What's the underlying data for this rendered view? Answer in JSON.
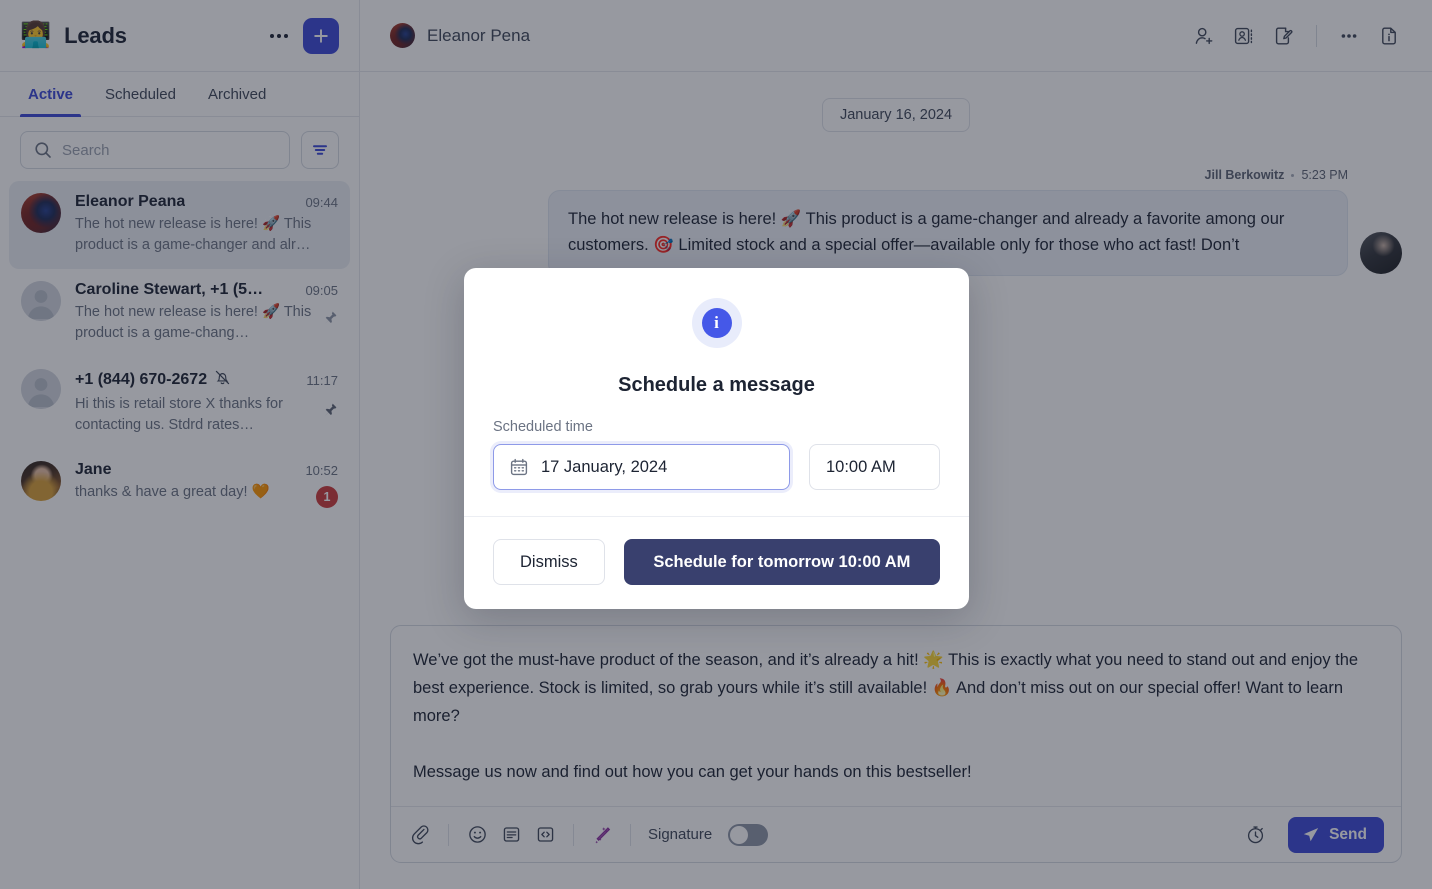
{
  "sidebar": {
    "emoji": "👩‍💻",
    "title": "Leads",
    "more_label": "",
    "add_label": "+",
    "tabs": [
      {
        "label": "Active",
        "active": true
      },
      {
        "label": "Scheduled",
        "active": false
      },
      {
        "label": "Archived",
        "active": false
      }
    ],
    "search": {
      "value": "",
      "placeholder": "Search"
    },
    "filter_icon": "filter-icon",
    "conversations": [
      {
        "name": "Eleanor Peana",
        "time": "09:44",
        "preview": "The hot new release is here! 🚀 This product is a game-changer and alr…",
        "selected": true,
        "pinned": false,
        "muted": false,
        "unread": "",
        "avatar": "eleanor"
      },
      {
        "name": "Caroline Stewart, +1 (54…",
        "time": "09:05",
        "preview": "The hot new release is here! 🚀 This product is a game-chang…",
        "selected": false,
        "pinned": true,
        "muted": false,
        "unread": "",
        "avatar": "generic"
      },
      {
        "name": "+1 (844) 670-2672",
        "time": "11:17",
        "preview": "Hi this is retail store X thanks for contacting us. Stdrd rates…",
        "selected": false,
        "pinned": true,
        "muted": true,
        "unread": "",
        "avatar": "generic"
      },
      {
        "name": "Jane",
        "time": "10:52",
        "preview": "thanks & have a great day! 🧡",
        "selected": false,
        "pinned": false,
        "muted": false,
        "unread": "1",
        "avatar": "jane"
      }
    ]
  },
  "header": {
    "contact_name": "Eleanor Pena",
    "actions": [
      "add-person-icon",
      "contact-card-icon",
      "document-edit-icon",
      "more-options-icon",
      "document-info-icon"
    ]
  },
  "thread": {
    "date_divider": "January 16, 2024",
    "message": {
      "author": "Jill Berkowitz",
      "time": "5:23 PM",
      "text": "The hot new release is here! 🚀 This product is a game-changer and already a favorite among our customers. 🎯 Limited stock and a special offer—available only for those who act fast! Don’t"
    }
  },
  "composer": {
    "paragraphs": [
      "We’ve got the must-have product of the season, and it’s already a hit! 🌟 This is exactly what you need to stand out and enjoy the best experience. Stock is limited, so grab yours while it’s still available! 🔥 And don’t miss out on our special offer! Want to learn more?",
      "",
      "Message us now and find out how you can get your hands on this bestseller!"
    ],
    "toolbar": {
      "attach_icon": "paperclip-icon",
      "emoji_icon": "emoji-icon",
      "template_icon": "template-icon",
      "code_icon": "code-icon",
      "magic_icon": "magic-wand-icon",
      "signature_label": "Signature",
      "signature_on": false,
      "schedule_icon": "stopwatch-icon",
      "send_label": "Send",
      "send_icon": "paper-plane-icon"
    }
  },
  "modal": {
    "info_icon": "info-icon",
    "info_glyph": "i",
    "title": "Schedule a message",
    "field_label": "Scheduled time",
    "date_icon": "calendar-icon",
    "date_value": "17 January, 2024",
    "time_value": "10:00 AM",
    "dismiss_label": "Dismiss",
    "schedule_label": "Schedule for tomorrow 10:00 AM"
  },
  "colors": {
    "accent": "#3c4ad8",
    "accent_info": "#4558e8",
    "primary_button": "#39406e",
    "badge_red": "#cd3b3b",
    "magic_purple": "#8b2fa0",
    "text": "#1d2433",
    "muted_text": "#6b7383",
    "border": "#d6dae2",
    "bubble_bg": "#edf1f8",
    "selected_row": "#eceef4",
    "overlay": "rgba(24,29,44,0.45)"
  }
}
